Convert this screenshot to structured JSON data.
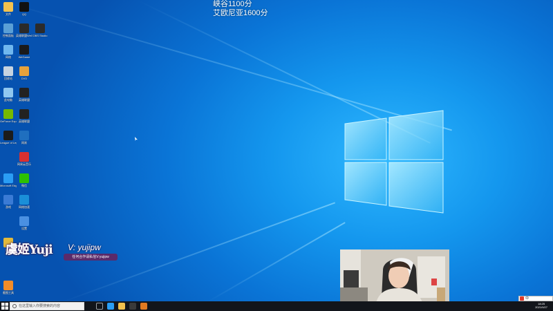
{
  "overlay": {
    "line1": "峡谷1100分",
    "line2": "艾欧尼亚1600分"
  },
  "desktop_icons": [
    {
      "label": "文件",
      "color": "#f2c14e"
    },
    {
      "label": "QQ",
      "color": "#111111"
    },
    {
      "label": "控制面板",
      "color": "#5a9fd6"
    },
    {
      "label": "英雄联盟WeGame",
      "color": "#2a2a2a"
    },
    {
      "label": "OBS Studio",
      "color": "#2b2b2b"
    },
    {
      "label": "网络",
      "color": "#6fb7ef"
    },
    {
      "label": "WeGame",
      "color": "#1a1a1a"
    },
    {
      "label": "回收站",
      "color": "#c7d3e0"
    },
    {
      "label": "DVD",
      "color": "#e7a23b"
    },
    {
      "label": "此电脑",
      "color": "#8fc7f0"
    },
    {
      "label": "英雄联盟",
      "color": "#222222"
    },
    {
      "label": "GeForce Experience",
      "color": "#76b900"
    },
    {
      "label": "英雄联盟",
      "color": "#222222"
    },
    {
      "label": "League of Legends",
      "color": "#1c1c1c"
    },
    {
      "label": "网易",
      "color": "#1f6fbf"
    },
    {
      "label": "网易云音乐",
      "color": "#d93030"
    },
    {
      "label": "Microsoft Edge",
      "color": "#2a9df4"
    },
    {
      "label": "微信",
      "color": "#2dc100"
    },
    {
      "label": "游戏",
      "color": "#3a7bd5"
    },
    {
      "label": "网络加速",
      "color": "#1a8fd8"
    },
    {
      "label": "设置",
      "color": "#4a90e2"
    },
    {
      "label": "应用",
      "color": "#e2b93b"
    },
    {
      "label": "截图工具",
      "color": "#f28c28"
    }
  ],
  "streamer_badge": {
    "name": "虞姬Yuji",
    "v_id": "V: yujipw",
    "subtitle": "任何合作请私信V:yujipw"
  },
  "taskbar": {
    "search_placeholder": "在这里输入你要搜索的内容",
    "clock_time": "18:25",
    "clock_date": "2021/9/27",
    "apps": [
      {
        "name": "task-view",
        "color": "#9aa0a6"
      },
      {
        "name": "edge",
        "color": "#2a9df4"
      },
      {
        "name": "explorer",
        "color": "#f2c14e"
      },
      {
        "name": "obs",
        "color": "#3a3a3a"
      },
      {
        "name": "app",
        "color": "#e07a22"
      }
    ]
  },
  "ime": {
    "label": "中"
  },
  "colors": {
    "desktop_bg": "#0a74d6",
    "logo_glow": "#7fe4ff",
    "taskbar": "#12151b"
  }
}
